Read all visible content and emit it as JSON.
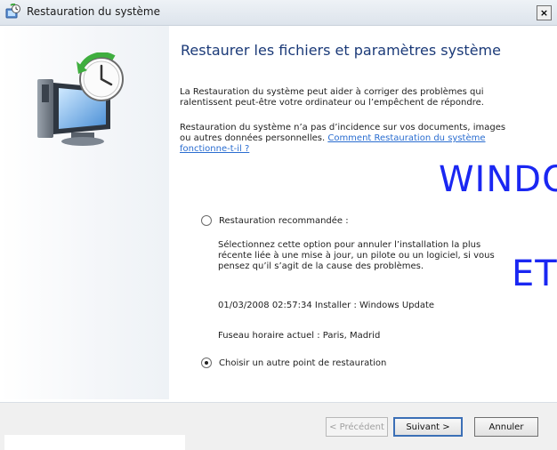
{
  "window": {
    "title": "Restauration du système",
    "close_glyph": "×"
  },
  "main": {
    "heading": "Restaurer les fichiers et paramètres système",
    "para1": "La Restauration du système peut aider à corriger des problèmes qui ralentissent peut-être votre ordinateur ou l’empêchent de répondre.",
    "para2": "Restauration du système n’a pas d’incidence sur vos documents, images ou autres données personnelles.",
    "help_link": "Comment Restauration du système fonctionne-t-il ?",
    "options": [
      {
        "label": "Restauration recommandée :",
        "selected": false
      },
      {
        "label": "Choisir un autre point de restauration",
        "selected": true
      }
    ],
    "recommended_desc": "Sélectionnez cette option pour annuler l’installation la plus récente liée à une mise à jour, un pilote ou un logiciel, si vous pensez qu’il s’agit de la cause des problèmes.",
    "restore_point": "01/03/2008 02:57:34 Installer : Windows Update",
    "timezone": "Fuseau horaire actuel : Paris, Madrid"
  },
  "overlay": {
    "line1": "WINDO",
    "line2": "ET"
  },
  "footer": {
    "prev_label": "< Précédent",
    "next_label": "Suivant >",
    "cancel_label": "Annuler"
  },
  "icons": {
    "title": "system-restore-icon",
    "hero": "computer-clock-restore-icon"
  },
  "colors": {
    "heading": "#1b3a78",
    "link": "#2a6dd0",
    "overlay": "#1a27f2"
  }
}
